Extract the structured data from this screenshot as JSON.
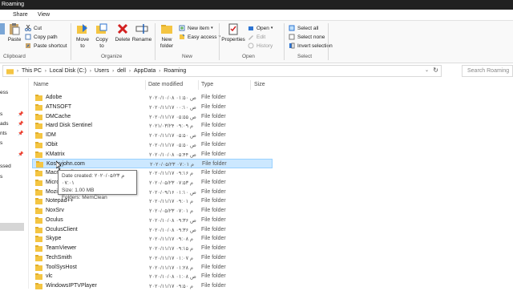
{
  "window": {
    "title": "Roaming"
  },
  "menu_tabs": [
    "Share",
    "View"
  ],
  "ribbon": {
    "clipboard": {
      "pin_label": "",
      "copy_label": "",
      "paste_label": "Paste",
      "cut": "Cut",
      "copy_path": "Copy path",
      "paste_shortcut": "Paste shortcut",
      "group": "Clipboard"
    },
    "organize": {
      "move_to": "Move to",
      "copy_to": "Copy to",
      "delete": "Delete",
      "rename": "Rename",
      "group": "Organize"
    },
    "new": {
      "new_folder": "New folder",
      "new_item": "New item",
      "easy_access": "Easy access",
      "group": "New"
    },
    "open": {
      "properties": "Properties",
      "open": "Open",
      "edit": "Edit",
      "history": "History",
      "group": "Open"
    },
    "select": {
      "select_all": "Select all",
      "select_none": "Select none",
      "invert_selection": "Invert selection",
      "group": "Select"
    }
  },
  "address": {
    "crumbs": [
      "This PC",
      "Local Disk (C:)",
      "Users",
      "dell",
      "AppData",
      "Roaming"
    ],
    "search_placeholder": "Search Roaming"
  },
  "nav": {
    "items": [
      "ess",
      "s",
      "ads",
      "nts",
      "s",
      "ssed",
      "s"
    ]
  },
  "columns": {
    "name": "Name",
    "date": "Date modified",
    "type": "Type",
    "size": "Size"
  },
  "files": [
    {
      "name": "Adobe",
      "date": "۲۰۲۰/۱۰/۰۸ ص ۰۱:۵۰",
      "type": "File folder"
    },
    {
      "name": "ATNSOFT",
      "date": "۲۰۲۰/۱۱/۱۷ ص ۰۰:۱۰",
      "type": "File folder"
    },
    {
      "name": "DMCache",
      "date": "۲۰۲۰/۱۱/۱۷ ص ۰۵:۵۵",
      "type": "File folder"
    },
    {
      "name": "Hard Disk Sentinel",
      "date": "۲۰۲۱/۰۳/۲۴ م ۰۹:۰۹",
      "type": "File folder"
    },
    {
      "name": "IDM",
      "date": "۲۰۲۰/۱۱/۱۷ ص ۰۵:۵۰",
      "type": "File folder"
    },
    {
      "name": "IObit",
      "date": "۲۰۲۰/۱۱/۱۷ ص ۰۵:۵۰",
      "type": "File folder"
    },
    {
      "name": "KMatrix",
      "date": "۲۰۲۰/۱۰/۰۸ ص ۰۵:۴۴",
      "type": "File folder"
    },
    {
      "name": "Koshyjohn.com",
      "date": "۲۰۲۰/۰۵/۲۳ م ۰۷:۰۱",
      "type": "File folder"
    },
    {
      "name": "Macromedia",
      "date": "۲۰۲۰/۱۱/۱۷ م ۰۹:۱۶",
      "type": "File folder"
    },
    {
      "name": "Microsoft",
      "date": "۲۰۲۰/۰۵/۲۳ م ۰۷:۵۳",
      "type": "File folder"
    },
    {
      "name": "Mozilla",
      "date": "۲۰۲۰/۰۹/۱۶ ص ۰۱:۱۰",
      "type": "File folder"
    },
    {
      "name": "Notepad++",
      "date": "۲۰۲۰/۱۱/۱۷ م ۰۹:۰۱",
      "type": "File folder"
    },
    {
      "name": "NoxSrv",
      "date": "۲۰۲۰/۰۵/۲۳ م ۰۷:۰۱",
      "type": "File folder"
    },
    {
      "name": "Oculus",
      "date": "۲۰۲۰/۱۰/۰۸ ص ۰۹:۳۶",
      "type": "File folder"
    },
    {
      "name": "OculusClient",
      "date": "۲۰۲۰/۱۰/۰۸ ص ۰۹:۳۶",
      "type": "File folder"
    },
    {
      "name": "Skype",
      "date": "۲۰۲۰/۱۱/۱۷ م ۰۹:۰۸",
      "type": "File folder"
    },
    {
      "name": "TeamViewer",
      "date": "۲۰۲۰/۱۱/۱۷ م ۰۹:۱۵",
      "type": "File folder"
    },
    {
      "name": "TechSmith",
      "date": "۲۰۲۰/۱۱/۱۷ م ۰۱:۰۷",
      "type": "File folder"
    },
    {
      "name": "ToolSysHost",
      "date": "۲۰۲۰/۱۱/۱۷ م ۰۱:۲۸",
      "type": "File folder"
    },
    {
      "name": "vlc",
      "date": "۲۰۲۰/۱۰/۰۸ ص ۰۱:۰۸",
      "type": "File folder"
    },
    {
      "name": "WindowsIPTVPlayer",
      "date": "۲۰۲۰/۱۱/۱۷ م ۰۹:۵۰",
      "type": "File folder"
    }
  ],
  "selected_index": 7,
  "tooltip": {
    "date_created": "Date created: ۲۰۲۰/۰۵/۲۳ م ۰۷:۰۱",
    "size": "Size: 1.00 MB",
    "folders": "Folders: MemClean"
  },
  "colors": {
    "folder": "#f4c542",
    "selection": "#cce8ff",
    "titlebar": "#202020"
  }
}
